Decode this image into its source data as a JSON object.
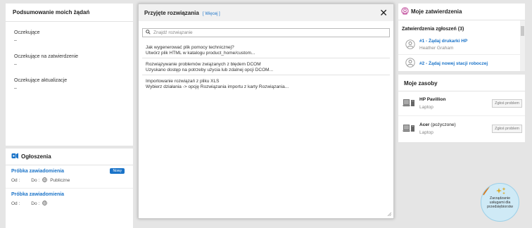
{
  "summary": {
    "title": "Podsumowanie moich żądań",
    "items": [
      {
        "label": "Oczekujące",
        "value": "–"
      },
      {
        "label": "Oczekujące na zatwierdzenie",
        "value": "–"
      },
      {
        "label": "Oczekujące aktualizacje",
        "value": "–"
      }
    ]
  },
  "announcements": {
    "title": "Ogłoszenia",
    "items": [
      {
        "title": "Próbka zawiadomienia",
        "from_label": "Od :",
        "to_label": "Do :",
        "visibility": "Publiczne",
        "badge": "Nowy"
      },
      {
        "title": "Próbka zawiadomienia",
        "from_label": "Od :",
        "to_label": "Do :",
        "visibility": "",
        "badge": ""
      }
    ]
  },
  "modal": {
    "title": "Przyjęte rozwiązania",
    "more_link": "[ Więcej ]",
    "search_placeholder": "Znajdź rozwiązanie",
    "solutions": [
      {
        "title": "Jak wygenerować plik pomocy technicznej?",
        "desc": "Utwórz plik HTML w katalogu product_home/custom..."
      },
      {
        "title": "Rozwiązywanie problemów związanych z błędem DCOM",
        "desc": "Uzyskano dostęp na potrzeby użycia lub zdalnej opcji DCOM..."
      },
      {
        "title": "Importowanie rozwiązań z pliku XLS",
        "desc": "Wybierz działania -> opcję Rozwiązania importu z karty Rozwiązania..."
      }
    ]
  },
  "approvals": {
    "title": "Moje zatwierdzenia",
    "sub_title": "Zatwierdzenia zgłoszeń (3)",
    "items": [
      {
        "link": "#1 - Żądaj drukarki HP",
        "user": "Heather Graham"
      },
      {
        "link": "#2 - Żądaj nowej stacji roboczej",
        "user": ""
      }
    ]
  },
  "assets": {
    "title": "Moje zasoby",
    "items": [
      {
        "name": "HP Pavillion",
        "note": "",
        "type": "Laptop",
        "button": "Zgłoś problem"
      },
      {
        "name": "Acer",
        "note": "(pożyczone)",
        "type": "Laptop",
        "button": "Zgłoś problem"
      }
    ]
  },
  "promo": {
    "text": "Zarządzanie usługami dla przedsiębiorstw"
  },
  "colors": {
    "accent": "#1a73c8",
    "badge": "#1a73c8",
    "ribbon": "#d87a1f"
  }
}
